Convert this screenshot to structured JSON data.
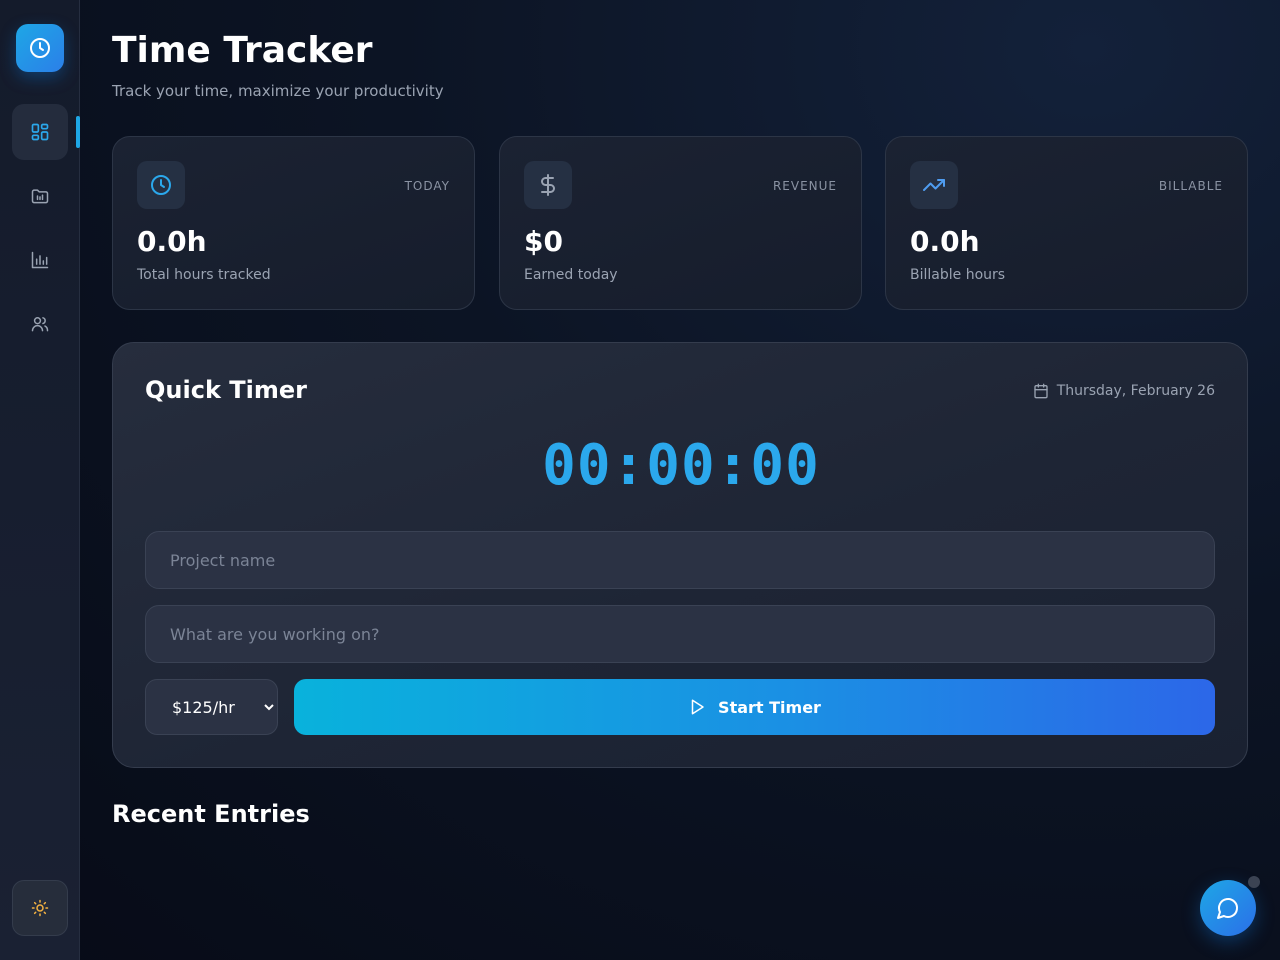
{
  "app": {
    "title": "Time Tracker",
    "subtitle": "Track your time, maximize your productivity"
  },
  "sidebar": {
    "logo_icon": "clock-icon",
    "items": [
      {
        "id": "dashboard",
        "icon": "dashboard-grid-icon",
        "active": true
      },
      {
        "id": "projects",
        "icon": "folder-icon",
        "active": false
      },
      {
        "id": "reports",
        "icon": "bar-chart-icon",
        "active": false
      },
      {
        "id": "team",
        "icon": "users-icon",
        "active": false
      }
    ],
    "theme_icon": "sun-icon"
  },
  "stats": [
    {
      "tag": "TODAY",
      "value": "0.0h",
      "label": "Total hours tracked",
      "icon": "clock-icon"
    },
    {
      "tag": "REVENUE",
      "value": "$0",
      "label": "Earned today",
      "icon": "dollar-icon"
    },
    {
      "tag": "BILLABLE",
      "value": "0.0h",
      "label": "Billable hours",
      "icon": "trending-up-icon"
    }
  ],
  "timer": {
    "title": "Quick Timer",
    "date": "Thursday, February 26",
    "display": "00:00:00",
    "project_placeholder": "Project name",
    "task_placeholder": "What are you working on?",
    "rate": "$125/hr",
    "start_label": "Start Timer"
  },
  "recent": {
    "title": "Recent Entries"
  },
  "colors": {
    "accent": "#2ba8ec",
    "gradient_start": "#09b2dc",
    "gradient_end": "#2c67e8",
    "theme_icon": "#f5b342"
  }
}
